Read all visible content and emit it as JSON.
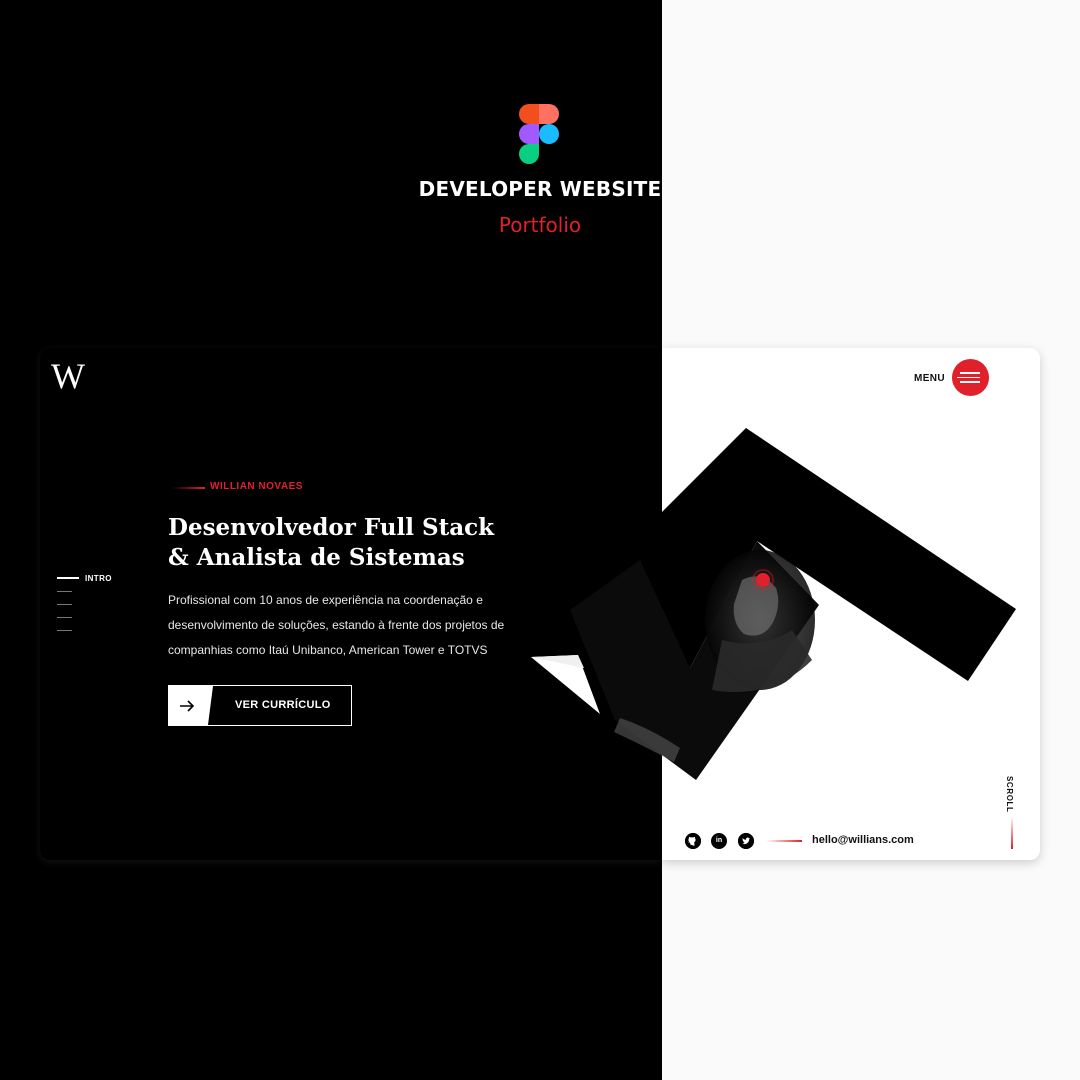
{
  "header": {
    "title": "DEVELOPER WEBSITE",
    "subtitle": "Portfolio"
  },
  "site": {
    "logo": "W",
    "nav": {
      "active_label": "INTRO"
    },
    "eyebrow": "WILLIAN NOVAES",
    "headline": [
      "Desenvolvedor  Full Stack",
      "& Analista de Sistemas"
    ],
    "description": [
      "Profissional com 10 anos de experiência na coordenação e",
      "desenvolvimento de soluções, estando à frente dos projetos de",
      "companhias como Itaú Unibanco, American Tower e TOTVS"
    ],
    "cta_label": "VER CURRÍCULO",
    "menu_label": "MENU",
    "scroll_label": "SCROLL",
    "email": "hello@willians.com",
    "social_icons": [
      "github-icon",
      "linkedin-icon",
      "twitter-icon"
    ]
  },
  "colors": {
    "accent": "#e0202a",
    "dark": "#000000",
    "light": "#fafafa"
  }
}
